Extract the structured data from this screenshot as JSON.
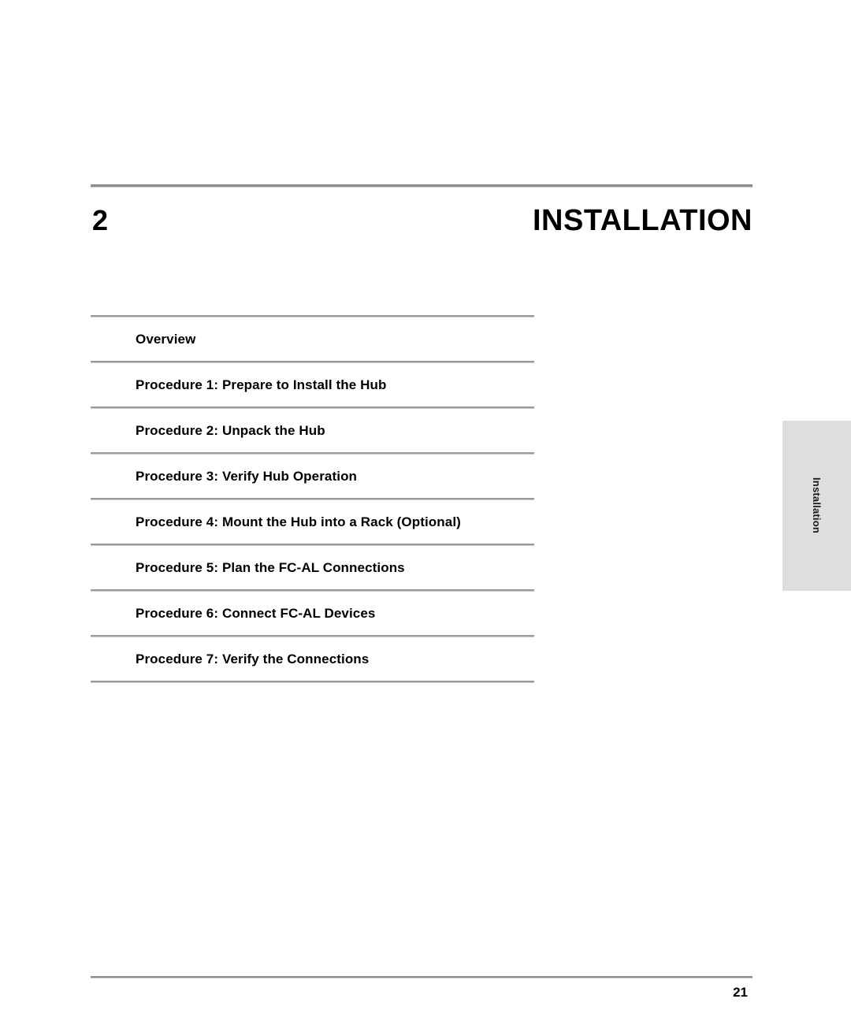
{
  "header": {
    "chapter_number": "2",
    "chapter_title": "INSTALLATION"
  },
  "toc": {
    "entries": [
      {
        "label": "Overview"
      },
      {
        "label": "Procedure 1: Prepare to Install the Hub"
      },
      {
        "label": "Procedure 2: Unpack the Hub"
      },
      {
        "label": "Procedure 3: Verify Hub Operation"
      },
      {
        "label": "Procedure 4: Mount the Hub into a Rack (Optional)"
      },
      {
        "label": "Procedure 5: Plan the FC-AL Connections"
      },
      {
        "label": "Procedure 6: Connect FC-AL Devices"
      },
      {
        "label": "Procedure 7: Verify the Connections"
      }
    ]
  },
  "side_tab": {
    "label": "Installation",
    "background_color": "#dedede"
  },
  "footer": {
    "page_number": "21"
  },
  "colors": {
    "rule_gray": "#8c8c8c",
    "toc_rule_gray": "#9a9a9a",
    "text_black": "#000000",
    "tab_gray": "#dedede"
  }
}
